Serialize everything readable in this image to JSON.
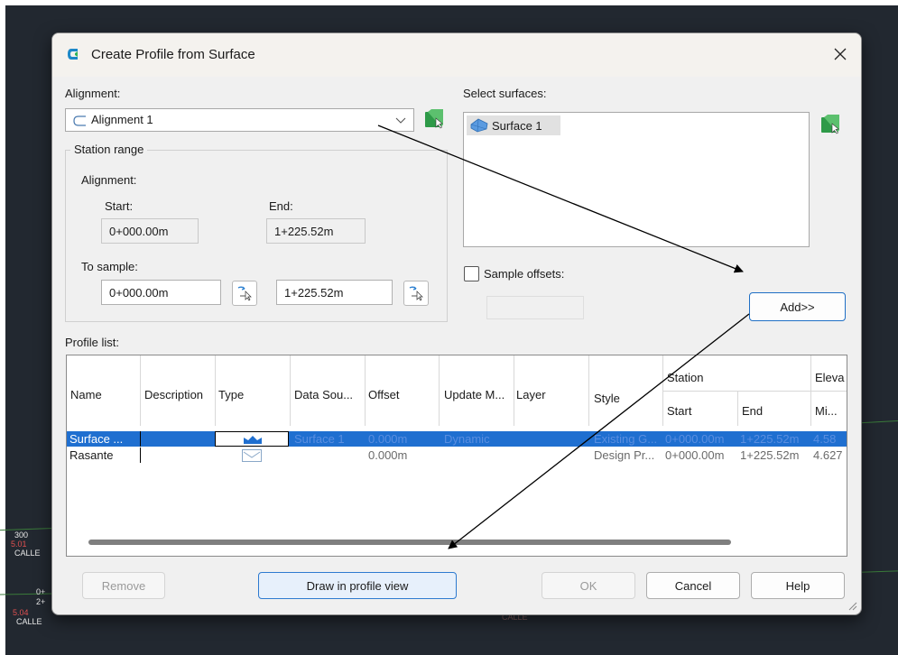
{
  "cad": {
    "texts_left": [
      "300",
      "5.01",
      "CALLE",
      "0+",
      "2+",
      "5.04",
      "CALLE"
    ],
    "text_bottom": "CALLE"
  },
  "dialog": {
    "title": "Create Profile from Surface",
    "alignment_label": "Alignment:",
    "alignment_value": "Alignment 1",
    "select_surfaces_label": "Select surfaces:",
    "surfaces": [
      "Surface 1"
    ],
    "station_range_label": "Station range",
    "alignment_sub_label": "Alignment:",
    "start_label": "Start:",
    "end_label": "End:",
    "start_value": "0+000.00m",
    "end_value": "1+225.52m",
    "to_sample_label": "To sample:",
    "sample_start": "0+000.00m",
    "sample_end": "1+225.52m",
    "sample_offsets_label": "Sample offsets:",
    "sample_offsets_checked": false,
    "add_button": "Add>>",
    "profile_list_label": "Profile list:",
    "columns": {
      "name": "Name",
      "description": "Description",
      "type": "Type",
      "data_source": "Data Sou...",
      "offset": "Offset",
      "update_mode": "Update M...",
      "layer": "Layer",
      "style": "Style",
      "station": "Station",
      "station_start": "Start",
      "station_end": "End",
      "elevation": "Eleva",
      "elevation_min": "Mi..."
    },
    "rows": [
      {
        "name": "Surface ...",
        "description": "",
        "data_source": "Surface 1",
        "offset": "0.000m",
        "update_mode": "Dynamic",
        "layer": "",
        "style": "Existing G...",
        "start": "0+000.00m",
        "end": "1+225.52m",
        "elev_min": "4.58"
      },
      {
        "name": "Rasante",
        "description": "",
        "data_source": "",
        "offset": "0.000m",
        "update_mode": "",
        "layer": "",
        "style": "Design Pr...",
        "start": "0+000.00m",
        "end": "1+225.52m",
        "elev_min": "4.627"
      }
    ],
    "buttons": {
      "remove": "Remove",
      "draw": "Draw in profile view",
      "ok": "OK",
      "cancel": "Cancel",
      "help": "Help"
    }
  },
  "colors": {
    "selection": "#1f6fd0",
    "cad_background": "#222830",
    "accent_green": "#2e9a48"
  }
}
